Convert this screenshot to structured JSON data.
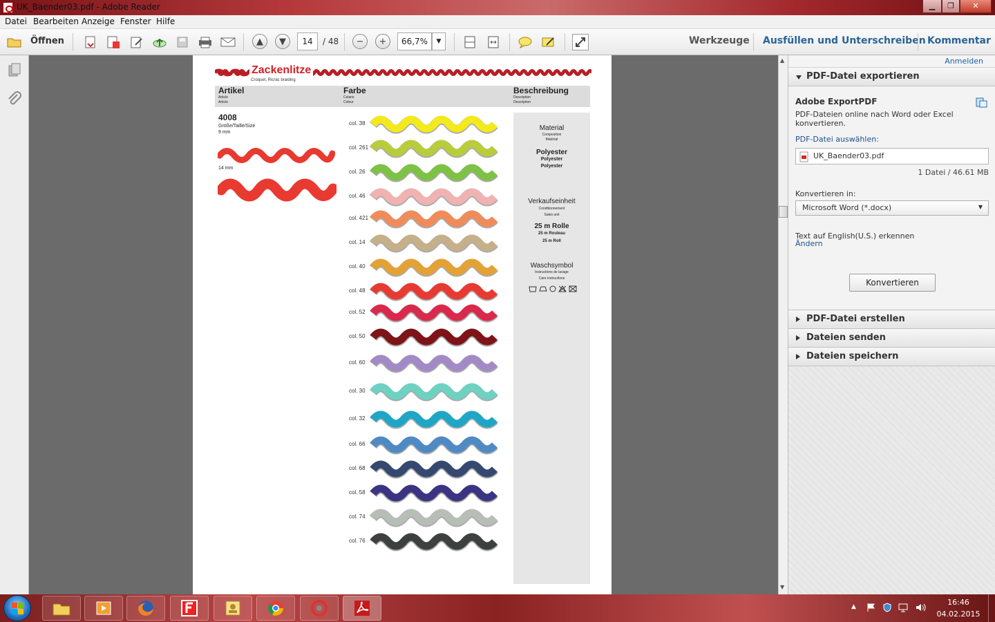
{
  "window": {
    "title": "UK_Baender03.pdf - Adobe Reader"
  },
  "menu": {
    "items": [
      "Datei",
      "Bearbeiten",
      "Anzeige",
      "Fenster",
      "Hilfe"
    ]
  },
  "toolbar": {
    "open_label": "Öffnen",
    "page_current": "14",
    "page_total": "/ 48",
    "zoom_value": "66,7%",
    "tools_link": "Werkzeuge",
    "fill_sign_link": "Ausfüllen und Unterschreiben",
    "comment_link": "Kommentar"
  },
  "right_panel": {
    "signin_link": "Anmelden",
    "export_section": "PDF-Datei exportieren",
    "service_title": "Adobe ExportPDF",
    "service_desc": "PDF-Dateien online nach Word oder Excel konvertieren.",
    "select_file_label": "PDF-Datei auswählen:",
    "file_name": "UK_Baender03.pdf",
    "file_info": "1 Datei / 46.61 MB",
    "convert_to_label": "Konvertieren in:",
    "convert_to_value": "Microsoft Word (*.docx)",
    "ocr_text": "Text auf English(U.S.) erkennen",
    "change_link": "Ändern",
    "convert_button": "Konvertieren",
    "create_section": "PDF-Datei erstellen",
    "send_section": "Dateien senden",
    "save_section": "Dateien speichern"
  },
  "document": {
    "title": "Zackenlitze",
    "subtitle": "Croquet, Ricrac braiding",
    "headers": {
      "artikel": "Artikel",
      "artikel_sub1": "Article",
      "artikel_sub2": "Article",
      "farbe": "Farbe",
      "farbe_sub1": "Colaris",
      "farbe_sub2": "Colour",
      "beschreibung": "Beschreibung",
      "beschreibung_sub1": "Description",
      "beschreibung_sub2": "Description"
    },
    "article": {
      "number": "4008",
      "size_label": "Größe/Taille/Size",
      "size_small": "9 mm",
      "size_large": "14 mm"
    },
    "colors": [
      {
        "label": "col. 38",
        "hex": "#f3ea1e"
      },
      {
        "label": "col. 261",
        "hex": "#b9cc3c"
      },
      {
        "label": "col. 26",
        "hex": "#7dc244"
      },
      {
        "label": "col. 46",
        "hex": "#f1b2b2"
      },
      {
        "label": "col. 421",
        "hex": "#f08c5a"
      },
      {
        "label": "col. 14",
        "hex": "#c6b08a"
      },
      {
        "label": "col. 40",
        "hex": "#e4a234"
      },
      {
        "label": "col. 48",
        "hex": "#e63a32"
      },
      {
        "label": "col. 52",
        "hex": "#d92a4c"
      },
      {
        "label": "col. 50",
        "hex": "#7e1418"
      },
      {
        "label": "col. 60",
        "hex": "#a28ac6"
      },
      {
        "label": "col. 30",
        "hex": "#6ed2c2"
      },
      {
        "label": "col. 32",
        "hex": "#1ea6c6"
      },
      {
        "label": "col. 66",
        "hex": "#4e8ac4"
      },
      {
        "label": "col. 68",
        "hex": "#344870"
      },
      {
        "label": "col. 58",
        "hex": "#3a3482"
      },
      {
        "label": "col. 74",
        "hex": "#b6beb6"
      },
      {
        "label": "col. 76",
        "hex": "#3c403e"
      }
    ],
    "description": {
      "material_title": "Material",
      "material_sub1": "Composition",
      "material_sub2": "Matérial",
      "material_value1": "Polyester",
      "material_value2": "Polyester",
      "material_value3": "Polyester",
      "unit_title": "Verkaufseinheit",
      "unit_sub1": "Conditionnement",
      "unit_sub2": "Sales unit",
      "unit_value1": "25 m Rolle",
      "unit_value2": "25 m Rouleau",
      "unit_value3": "25 m Roll",
      "wash_title": "Waschsymbol",
      "wash_sub1": "Instructions de lavage",
      "wash_sub2": "Care instructions"
    }
  },
  "taskbar": {
    "time": "16:46",
    "date": "04.02.2015"
  }
}
